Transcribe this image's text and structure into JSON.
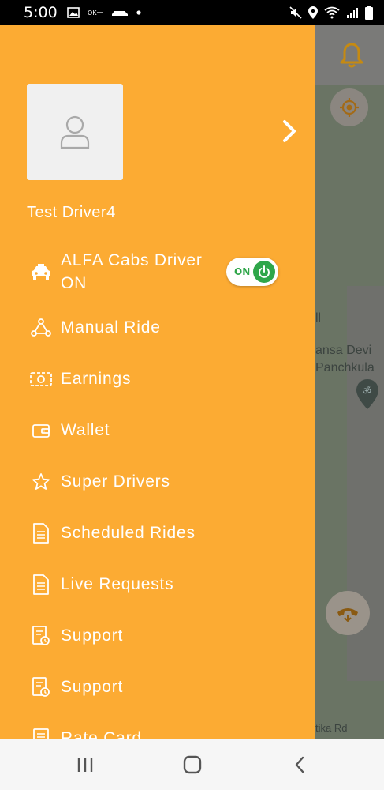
{
  "status_bar": {
    "time": "5:00",
    "left_icons": [
      "image-icon",
      "notification-icon",
      "car-icon",
      "dot-icon"
    ],
    "right_icons": [
      "mute-icon",
      "location-icon",
      "wifi-icon",
      "signal-icon",
      "battery-icon"
    ]
  },
  "drawer": {
    "driver_name": "Test Driver4",
    "toggle": {
      "label": "ON",
      "state": true,
      "color": "#2fa64a"
    },
    "items": [
      {
        "icon": "taxi-icon",
        "label": "ALFA Cabs Driver ON"
      },
      {
        "icon": "share-nodes-icon",
        "label": "Manual Ride"
      },
      {
        "icon": "money-icon",
        "label": "Earnings"
      },
      {
        "icon": "wallet-icon",
        "label": "Wallet"
      },
      {
        "icon": "star-icon",
        "label": "Super Drivers"
      },
      {
        "icon": "document-icon",
        "label": "Scheduled Rides"
      },
      {
        "icon": "document-icon",
        "label": "Live Requests"
      },
      {
        "icon": "support-doc-icon",
        "label": "Support"
      },
      {
        "icon": "support-doc-icon",
        "label": "Support"
      },
      {
        "icon": "card-icon",
        "label": "Rate Card"
      }
    ],
    "background_color": "#fcab33"
  },
  "map": {
    "labels": [
      "ll",
      "ansa Devi",
      "Panchkula",
      "tika Rd"
    ]
  },
  "nav_bar": {
    "buttons": [
      "recents-icon",
      "home-icon",
      "back-icon"
    ]
  }
}
